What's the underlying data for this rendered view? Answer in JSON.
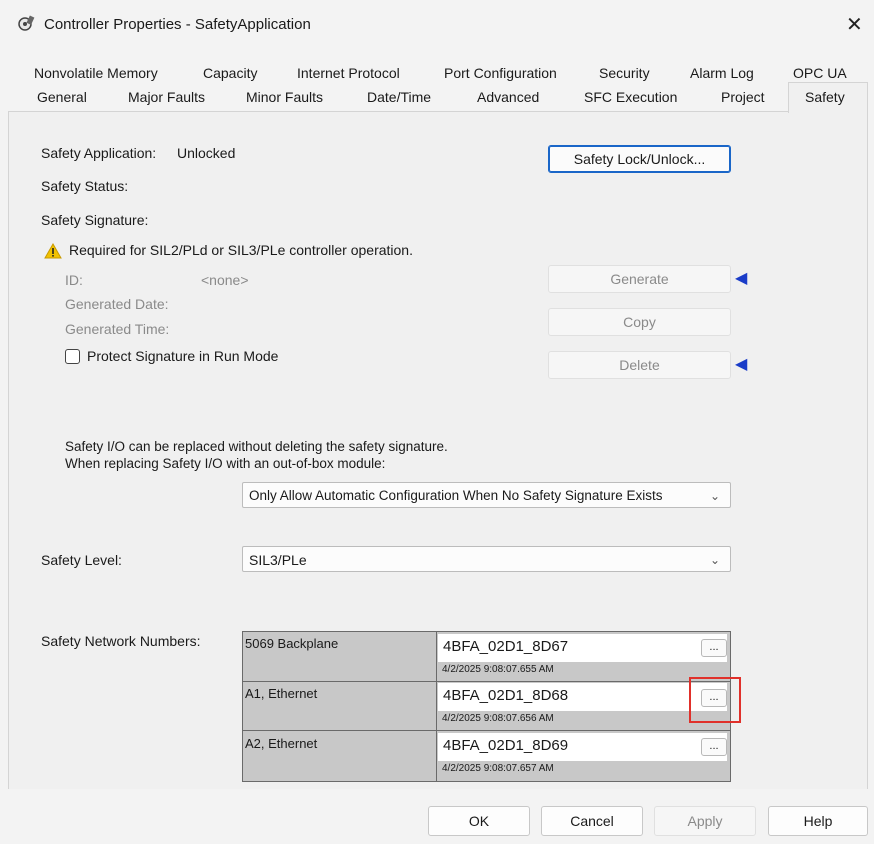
{
  "window": {
    "title": "Controller Properties - SafetyApplication",
    "close_icon": "✕"
  },
  "tabs_row1": [
    "Nonvolatile Memory",
    "Capacity",
    "Internet Protocol",
    "Port Configuration",
    "Security",
    "Alarm Log",
    "OPC UA"
  ],
  "tabs_row2": [
    "General",
    "Major Faults",
    "Minor Faults",
    "Date/Time",
    "Advanced",
    "SFC Execution",
    "Project",
    "Safety"
  ],
  "safety": {
    "application_label": "Safety Application:",
    "application_value": "Unlocked",
    "lock_button": "Safety Lock/Unlock...",
    "status_label": "Safety Status:",
    "signature_label": "Safety Signature:",
    "warning_text": "Required for SIL2/PLd or SIL3/PLe controller operation.",
    "id_label": "ID:",
    "id_value": "<none>",
    "generated_date_label": "Generated Date:",
    "generated_time_label": "Generated Time:",
    "generate_button": "Generate",
    "copy_button": "Copy",
    "delete_button": "Delete",
    "protect_label": "Protect Signature in Run Mode",
    "io_text_1": "Safety I/O can be replaced without deleting the safety signature.",
    "io_text_2": "When replacing Safety I/O with an out-of-box module:",
    "io_select": "Only Allow Automatic Configuration When No Safety Signature Exists",
    "level_label": "Safety Level:",
    "level_select": "SIL3/PLe",
    "network_label": "Safety Network Numbers:"
  },
  "networks": [
    {
      "name": "5069 Backplane",
      "value": "4BFA_02D1_8D67",
      "date": "4/2/2025 9:08:07.655 AM",
      "button": "..."
    },
    {
      "name": "A1, Ethernet",
      "value": "4BFA_02D1_8D68",
      "date": "4/2/2025 9:08:07.656 AM",
      "button": "..."
    },
    {
      "name": "A2, Ethernet",
      "value": "4BFA_02D1_8D69",
      "date": "4/2/2025 9:08:07.657 AM",
      "button": "..."
    }
  ],
  "footer": {
    "ok": "OK",
    "cancel": "Cancel",
    "apply": "Apply",
    "help": "Help"
  },
  "icons": {
    "warning": "warning-icon",
    "arrow": "blue-arrow-icon",
    "chevron": "chevron-down-icon"
  },
  "colors": {
    "arrow": "#1a3cc8",
    "highlight": "#e0302a",
    "warning": "#f2c200"
  }
}
